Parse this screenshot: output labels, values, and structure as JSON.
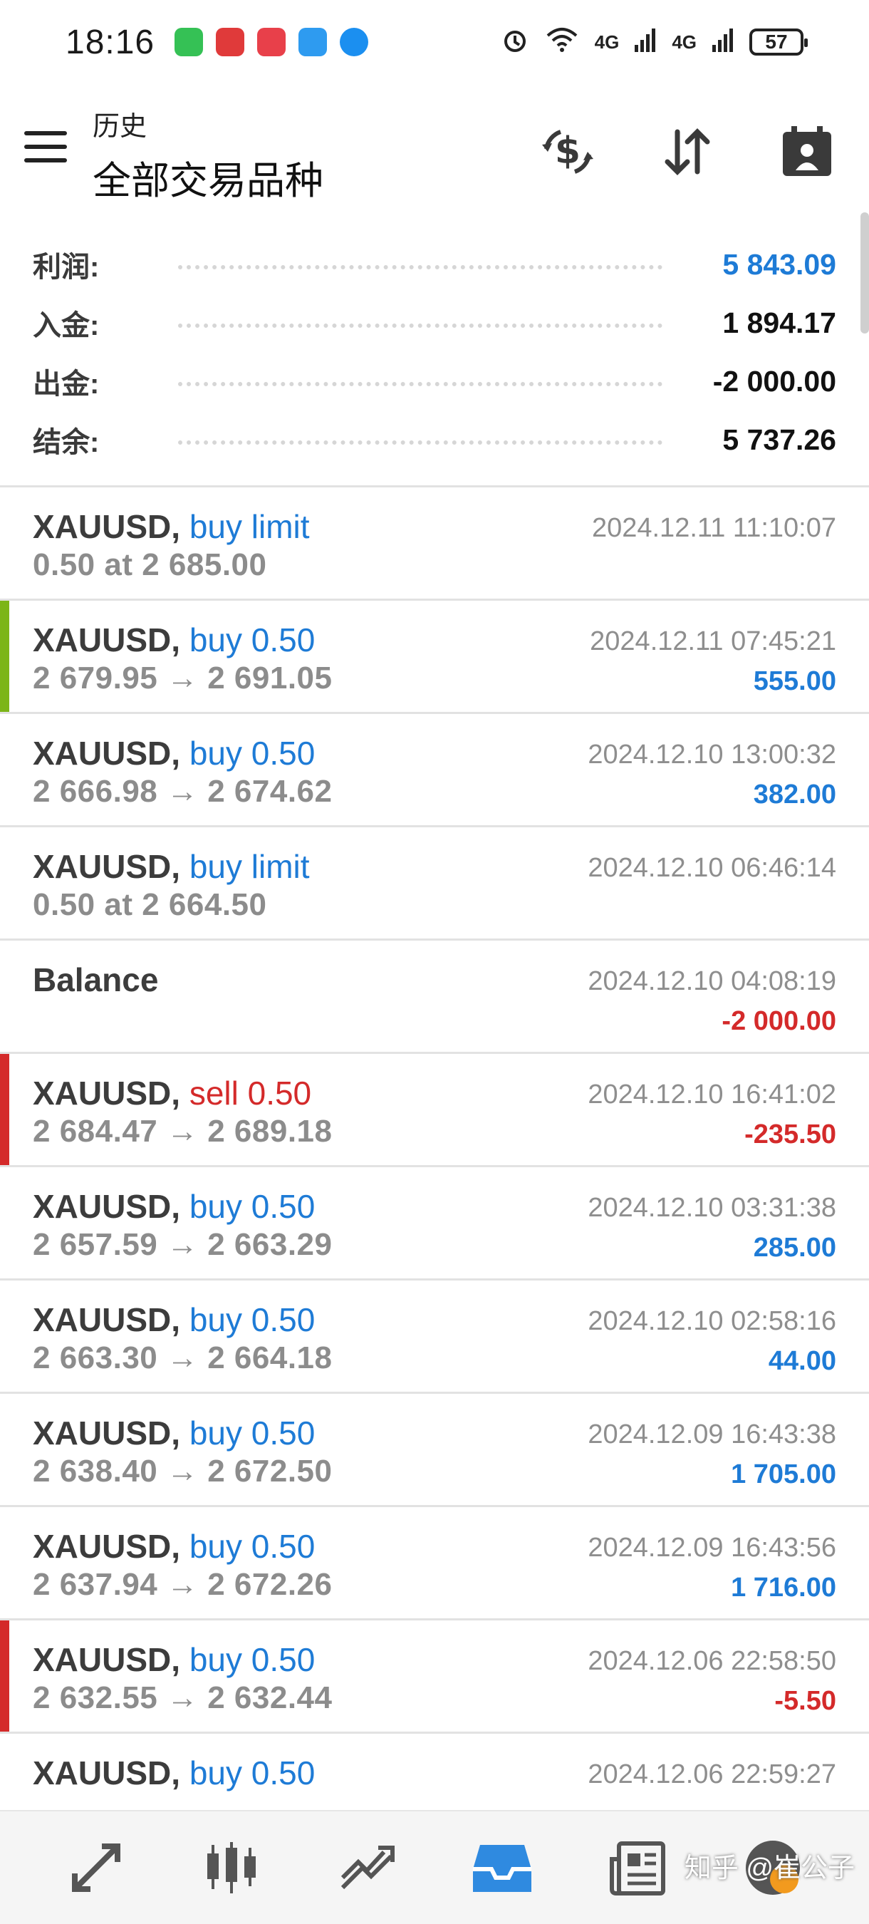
{
  "status_bar": {
    "time": "18:16",
    "network_left": "4G",
    "network_right": "4G",
    "battery": "57"
  },
  "header": {
    "title_small": "历史",
    "title_big": "全部交易品种"
  },
  "summary": [
    {
      "label": "利润:",
      "value": "5 843.09",
      "color": "#1e7bd6"
    },
    {
      "label": "入金:",
      "value": "1 894.17",
      "color": "#111111"
    },
    {
      "label": "出金:",
      "value": "-2 000.00",
      "color": "#111111"
    },
    {
      "label": "结余:",
      "value": "5 737.26",
      "color": "#111111"
    }
  ],
  "deals": [
    {
      "symbol": "XAUUSD,",
      "kind": "buy limit",
      "kind_color": "blue",
      "detail": "0.50 at 2 685.00",
      "time": "2024.12.11 11:10:07",
      "profit": "",
      "profit_color": "blue",
      "marker": ""
    },
    {
      "symbol": "XAUUSD,",
      "kind": "buy 0.50",
      "kind_color": "blue",
      "detail": "2 679.95 → 2 691.05",
      "time": "2024.12.11 07:45:21",
      "profit": "555.00",
      "profit_color": "blue",
      "marker": "#7cb518"
    },
    {
      "symbol": "XAUUSD,",
      "kind": "buy 0.50",
      "kind_color": "blue",
      "detail": "2 666.98 → 2 674.62",
      "time": "2024.12.10 13:00:32",
      "profit": "382.00",
      "profit_color": "blue",
      "marker": ""
    },
    {
      "symbol": "XAUUSD,",
      "kind": "buy limit",
      "kind_color": "blue",
      "detail": "0.50 at 2 664.50",
      "time": "2024.12.10 06:46:14",
      "profit": "",
      "profit_color": "blue",
      "marker": ""
    },
    {
      "symbol": "Balance",
      "kind": "",
      "kind_color": "blue",
      "detail": "",
      "time": "2024.12.10 04:08:19",
      "profit": "-2 000.00",
      "profit_color": "red",
      "marker": ""
    },
    {
      "symbol": "XAUUSD,",
      "kind": "sell 0.50",
      "kind_color": "red",
      "detail": "2 684.47 → 2 689.18",
      "time": "2024.12.10 16:41:02",
      "profit": "-235.50",
      "profit_color": "red",
      "marker": "#d42a2a"
    },
    {
      "symbol": "XAUUSD,",
      "kind": "buy 0.50",
      "kind_color": "blue",
      "detail": "2 657.59 → 2 663.29",
      "time": "2024.12.10 03:31:38",
      "profit": "285.00",
      "profit_color": "blue",
      "marker": ""
    },
    {
      "symbol": "XAUUSD,",
      "kind": "buy 0.50",
      "kind_color": "blue",
      "detail": "2 663.30 → 2 664.18",
      "time": "2024.12.10 02:58:16",
      "profit": "44.00",
      "profit_color": "blue",
      "marker": ""
    },
    {
      "symbol": "XAUUSD,",
      "kind": "buy 0.50",
      "kind_color": "blue",
      "detail": "2 638.40 → 2 672.50",
      "time": "2024.12.09 16:43:38",
      "profit": "1 705.00",
      "profit_color": "blue",
      "marker": ""
    },
    {
      "symbol": "XAUUSD,",
      "kind": "buy 0.50",
      "kind_color": "blue",
      "detail": "2 637.94 → 2 672.26",
      "time": "2024.12.09 16:43:56",
      "profit": "1 716.00",
      "profit_color": "blue",
      "marker": ""
    },
    {
      "symbol": "XAUUSD,",
      "kind": "buy 0.50",
      "kind_color": "blue",
      "detail": "2 632.55 → 2 632.44",
      "time": "2024.12.06 22:58:50",
      "profit": "-5.50",
      "profit_color": "red",
      "marker": "#d42a2a"
    },
    {
      "symbol": "XAUUSD,",
      "kind": "buy 0.50",
      "kind_color": "blue",
      "detail": "",
      "time": "2024.12.06 22:59:27",
      "profit": "",
      "profit_color": "red",
      "marker": ""
    }
  ],
  "bottom_nav": [
    {
      "icon": "quotes-icon"
    },
    {
      "icon": "chart-icon"
    },
    {
      "icon": "trade-icon"
    },
    {
      "icon": "history-icon",
      "active": true
    },
    {
      "icon": "news-icon"
    },
    {
      "icon": "chat-icon"
    }
  ],
  "watermark": "知乎 @崔公子",
  "colors": {
    "accent_blue": "#1e7bd6",
    "loss_red": "#d42a2a",
    "profit_green_marker": "#7cb518"
  }
}
